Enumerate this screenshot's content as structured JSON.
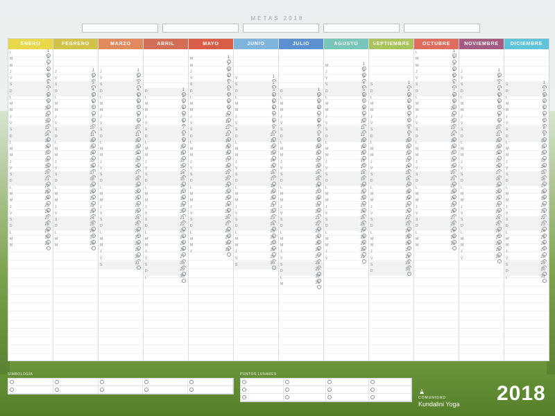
{
  "title": "METAS 2018",
  "goal_boxes": 5,
  "months": [
    {
      "name": "ENERO",
      "color": "#e9d84a",
      "start": 0,
      "days": 31
    },
    {
      "name": "FEBRERO",
      "color": "#d3c24a",
      "start": 3,
      "days": 28
    },
    {
      "name": "MARZO",
      "color": "#e08a5e",
      "start": 3,
      "days": 31
    },
    {
      "name": "ABRIL",
      "color": "#d36d55",
      "start": 6,
      "days": 30
    },
    {
      "name": "MAYO",
      "color": "#d95e47",
      "start": 1,
      "days": 31
    },
    {
      "name": "JUNIO",
      "color": "#7fb5dd",
      "start": 4,
      "days": 30
    },
    {
      "name": "JULIO",
      "color": "#5d90cf",
      "start": 6,
      "days": 31
    },
    {
      "name": "AGOSTO",
      "color": "#78c5b9",
      "start": 2,
      "days": 31
    },
    {
      "name": "SEPTIEMBRE",
      "color": "#a9c35a",
      "start": 5,
      "days": 30
    },
    {
      "name": "OCTUBRE",
      "color": "#e06c5e",
      "start": 0,
      "days": 31
    },
    {
      "name": "NOVIEMBRE",
      "color": "#a45b82",
      "start": 3,
      "days": 30
    },
    {
      "name": "DICIEMBRE",
      "color": "#5fc3d9",
      "start": 5,
      "days": 31
    }
  ],
  "weekday_letters": [
    "L",
    "M",
    "M",
    "J",
    "V",
    "S",
    "D"
  ],
  "notes_label": "SIMBOLOGÍA",
  "moon_label": "PUNTOS LUNARES",
  "brand": {
    "small": "COMUNIDAD",
    "name": "Kundalini Yoga"
  },
  "year": "2018"
}
